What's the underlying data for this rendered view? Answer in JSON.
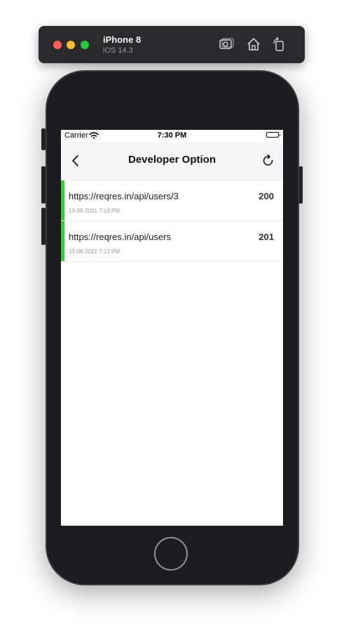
{
  "simulator": {
    "device": "iPhone 8",
    "os": "iOS 14.3"
  },
  "status_bar": {
    "carrier": "Carrier",
    "time": "7:30 PM"
  },
  "nav": {
    "title": "Developer Option"
  },
  "logs": [
    {
      "url": "https://reqres.in/api/users/3",
      "code": "200",
      "timestamp": "13-06-2021 7:13 PM",
      "status_color": "#22dd22"
    },
    {
      "url": "https://reqres.in/api/users",
      "code": "201",
      "timestamp": "13-06-2021 7:13 PM",
      "status_color": "#22dd22"
    }
  ],
  "icons": {
    "screenshot": "screenshot-icon",
    "home": "home-icon",
    "rotate": "rotate-icon",
    "back": "chevron-left-icon",
    "refresh": "refresh-icon",
    "wifi": "wifi-icon",
    "battery": "battery-icon"
  }
}
